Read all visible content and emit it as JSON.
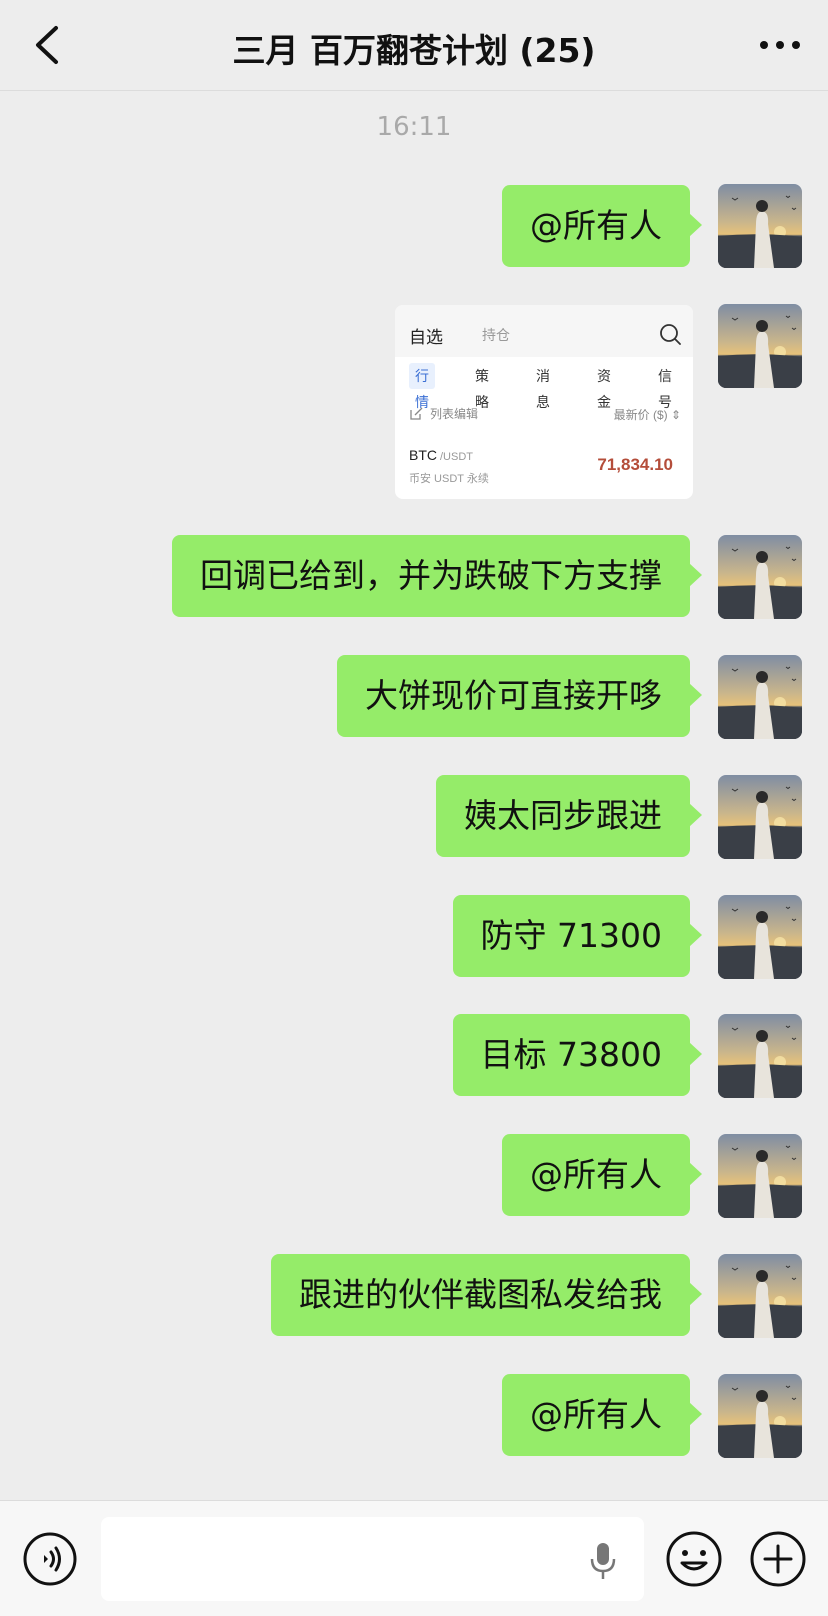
{
  "header": {
    "title": "三月 百万翻苍计划 (25)",
    "back_icon": "chevron-left-icon",
    "more_icon": "more-dots-icon"
  },
  "chat": {
    "timestamp": "16:11",
    "messages": [
      {
        "type": "text",
        "text": "@所有人"
      },
      {
        "type": "image"
      },
      {
        "type": "text",
        "text": "回调已给到，并为跌破下方支撑"
      },
      {
        "type": "text",
        "text": "大饼现价可直接开哆"
      },
      {
        "type": "text",
        "text": "姨太同步跟进"
      },
      {
        "type": "text",
        "text": "防守 71300"
      },
      {
        "type": "text",
        "text": "目标 73800"
      },
      {
        "type": "text",
        "text": "@所有人"
      },
      {
        "type": "text",
        "text": "跟进的伙伴截图私发给我"
      },
      {
        "type": "text",
        "text": "@所有人"
      }
    ]
  },
  "screenshot_card": {
    "tab_watchlist": "自选",
    "tab_positions": "持仓",
    "chips": [
      "行情",
      "策略",
      "消息",
      "资金",
      "信号"
    ],
    "active_chip": "行情",
    "edit_list": "列表编辑",
    "price_header": "最新价 ($) ⇕",
    "coin_symbol": "BTC",
    "coin_pair": "/USDT",
    "coin_market": "币安 USDT 永续",
    "coin_price": "71,834.10"
  },
  "input_bar": {
    "placeholder": "",
    "icons": [
      "voice-icon",
      "microphone-icon",
      "emoji-icon",
      "plus-icon"
    ]
  },
  "colors": {
    "bubble": "#95ec69",
    "background": "#ededed",
    "price": "#b44d3a"
  }
}
